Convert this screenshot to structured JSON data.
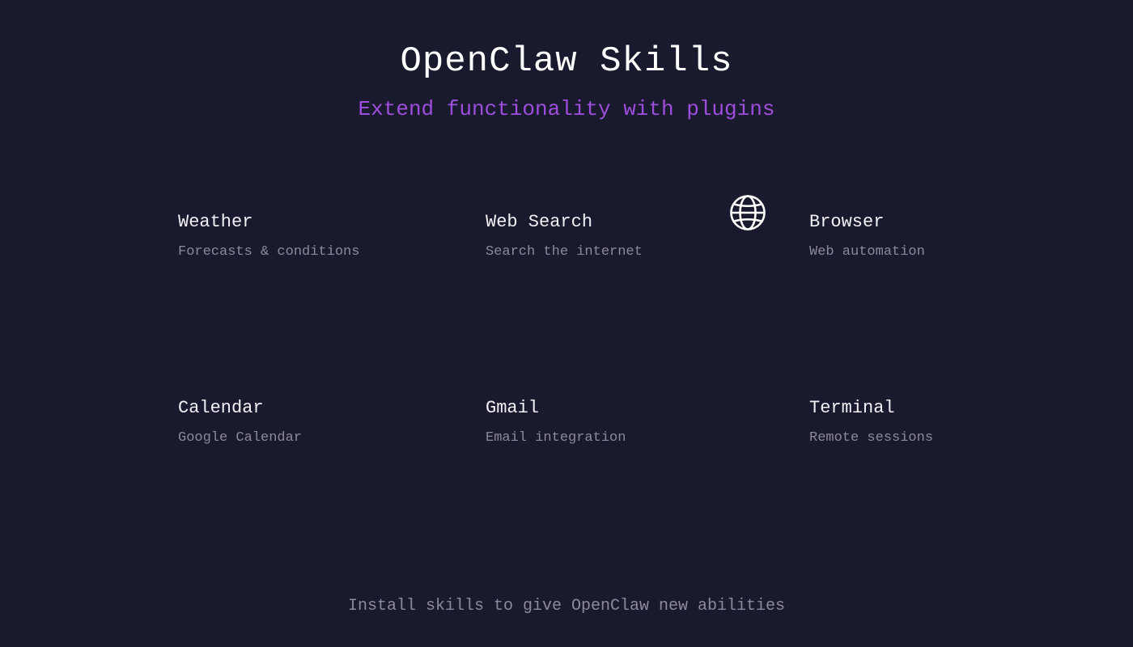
{
  "header": {
    "title": "OpenClaw Skills",
    "subtitle": "Extend functionality with plugins"
  },
  "skills": [
    {
      "name": "Weather",
      "description": "Forecasts & conditions"
    },
    {
      "name": "Web Search",
      "description": "Search the internet"
    },
    {
      "name": "Browser",
      "description": "Web automation",
      "icon": "globe-icon"
    },
    {
      "name": "Calendar",
      "description": "Google Calendar"
    },
    {
      "name": "Gmail",
      "description": "Email integration"
    },
    {
      "name": "Terminal",
      "description": "Remote sessions"
    }
  ],
  "footer": {
    "text": "Install skills to give OpenClaw new abilities"
  },
  "colors": {
    "background": "#1a1a2e",
    "accent": "#9d4edd",
    "muted": "#8a8a9a",
    "text": "#ffffff"
  }
}
